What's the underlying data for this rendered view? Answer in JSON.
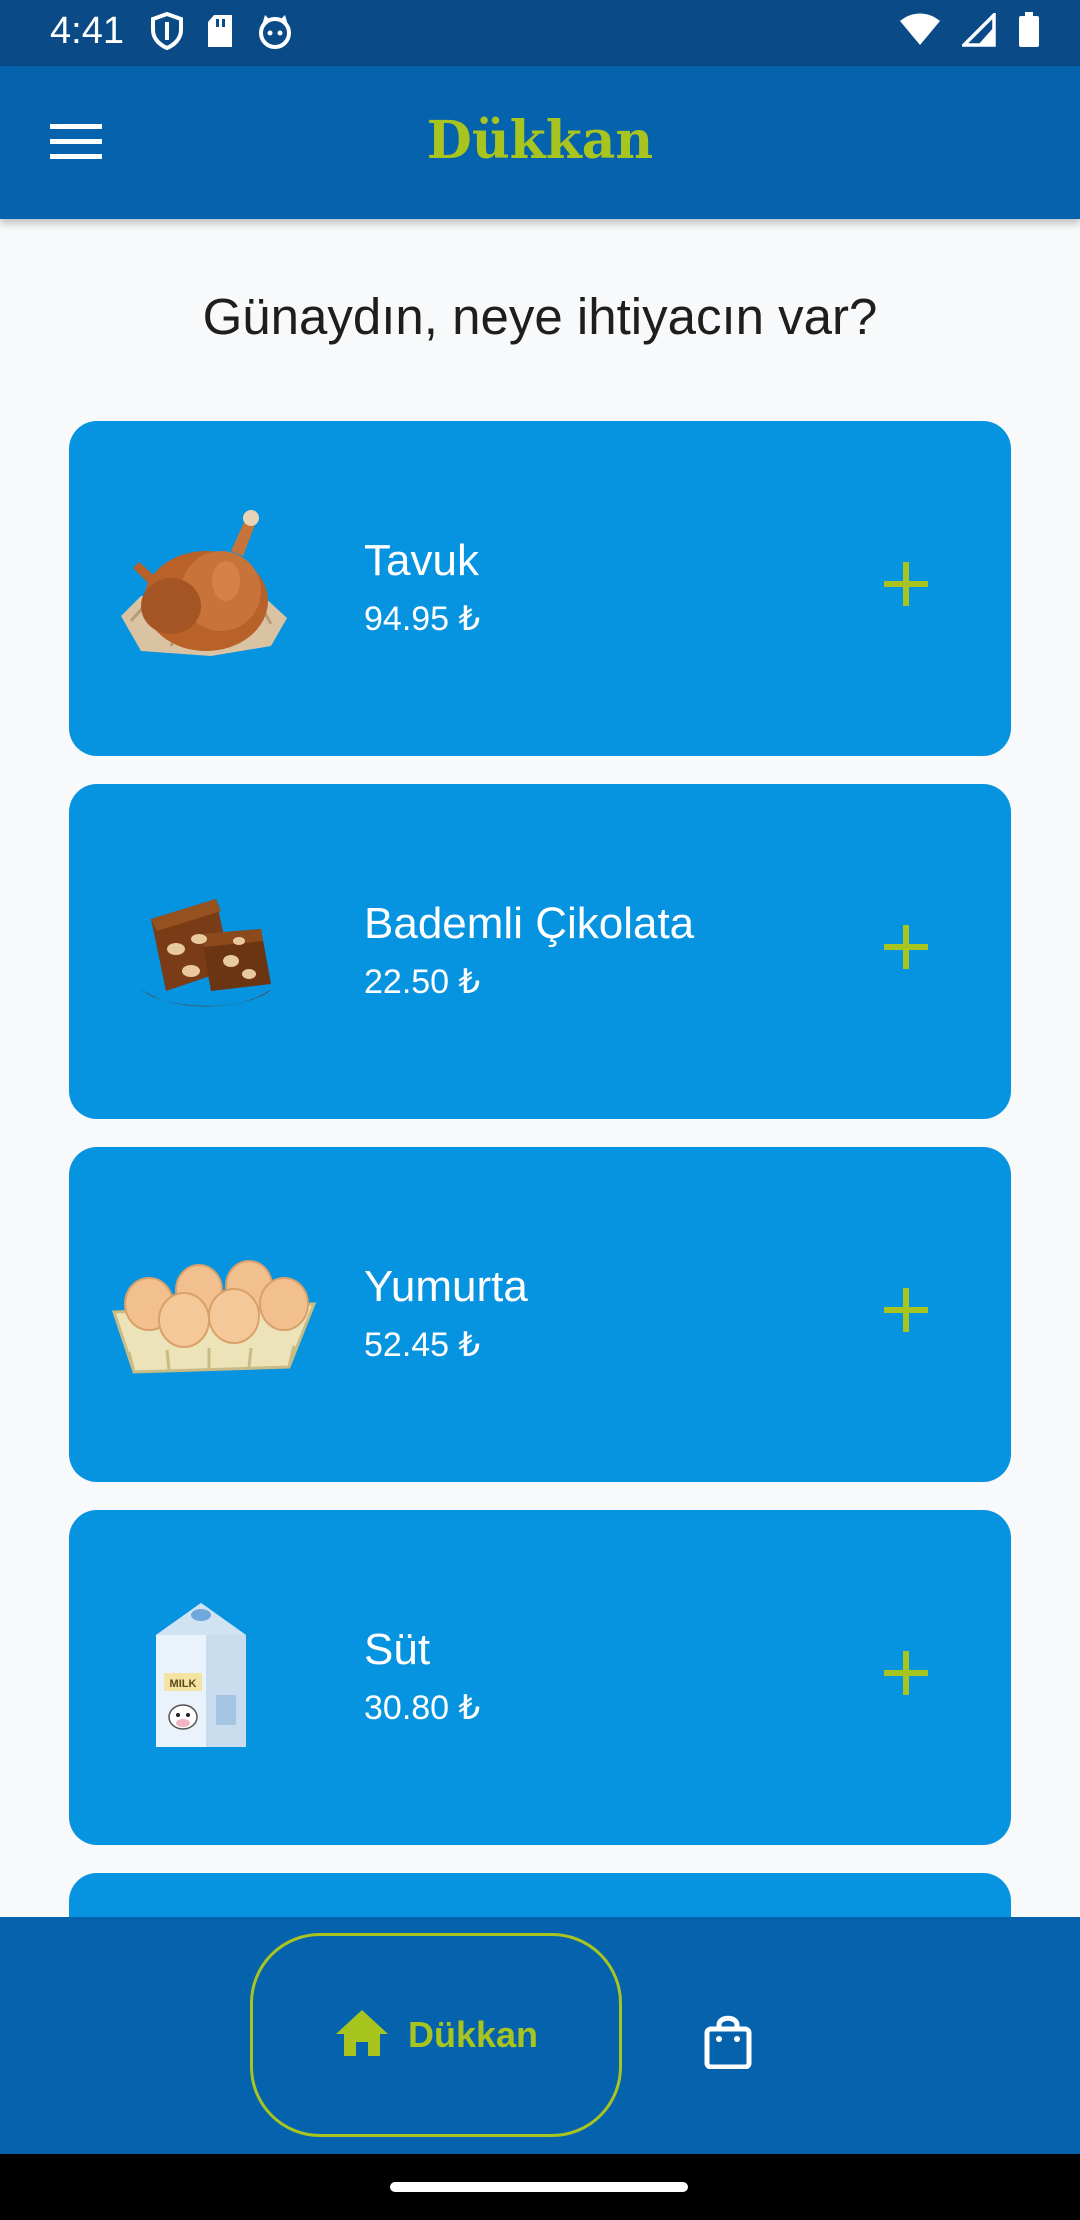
{
  "status_bar": {
    "time": "4:41",
    "left_icons": [
      "shield-icon",
      "sd-card-icon",
      "cat-face-icon"
    ],
    "right_icons": [
      "wifi-icon",
      "signal-icon",
      "battery-icon"
    ]
  },
  "app_bar": {
    "title": "Dükkan",
    "menu_icon": "hamburger-menu-icon"
  },
  "greeting": "Günaydın, neye ihtiyacın var?",
  "products": [
    {
      "name": "Tavuk",
      "price": "94.95 ₺",
      "image": "roast-chicken"
    },
    {
      "name": "Bademli Çikolata",
      "price": "22.50 ₺",
      "image": "almond-chocolate"
    },
    {
      "name": "Yumurta",
      "price": "52.45 ₺",
      "image": "egg-carton"
    },
    {
      "name": "Süt",
      "price": "30.80 ₺",
      "image": "milk-carton"
    }
  ],
  "milk_carton_label": "MILK",
  "bottom_nav": {
    "home_label": "Dükkan",
    "home_icon": "home-icon",
    "cart_icon": "shopping-bag-icon"
  },
  "colors": {
    "app_bar": "#0563AE",
    "card": "#0693E0",
    "accent": "#A8C41E",
    "background": "#F7F9FA"
  }
}
